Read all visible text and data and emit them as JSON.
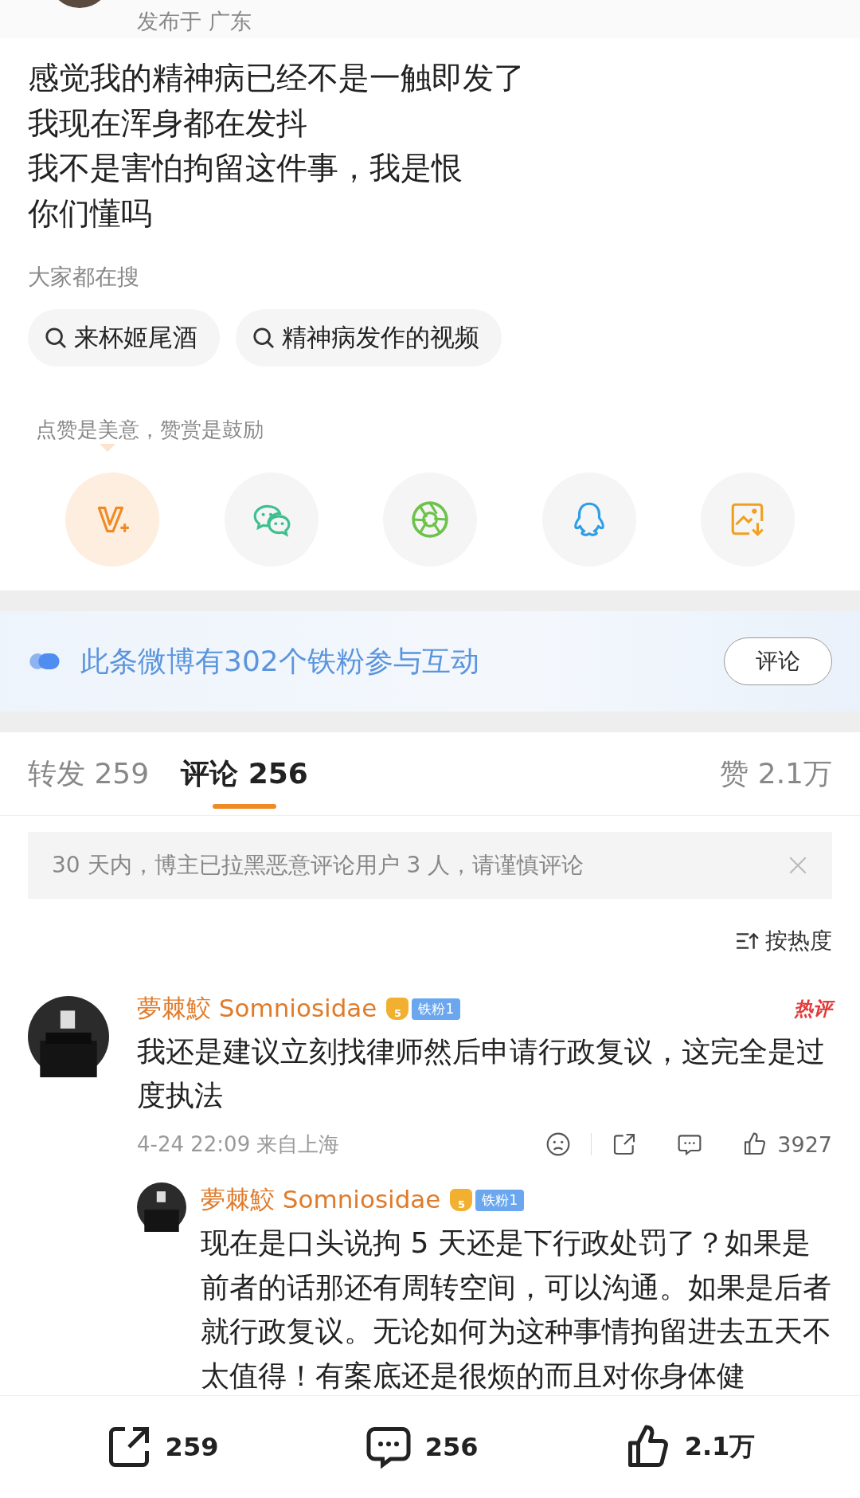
{
  "post": {
    "location": "发布于 广东",
    "lines": [
      "感觉我的精神病已经不是一触即发了",
      "我现在浑身都在发抖",
      "我不是害怕拘留这件事，我是恨",
      "你们懂吗"
    ]
  },
  "trending": {
    "title": "大家都在搜",
    "queries": [
      "来杯姬尾酒",
      "精神病发作的视频"
    ]
  },
  "tip": "点赞是美意，赞赏是鼓励",
  "share_targets": [
    {
      "kind": "reward"
    },
    {
      "kind": "wechat"
    },
    {
      "kind": "moments"
    },
    {
      "kind": "qq"
    },
    {
      "kind": "save_image"
    }
  ],
  "fans_banner": {
    "text": "此条微博有302个铁粉参与互动",
    "button": "评论"
  },
  "tabs": [
    {
      "label": "转发",
      "count": "259",
      "selected": false
    },
    {
      "label": "评论",
      "count": "256",
      "selected": true
    }
  ],
  "likes": {
    "label": "赞",
    "count": "2.1万"
  },
  "notice": "30 天内，博主已拉黑恶意评论用户 3 人，请谨慎评论",
  "sort": "按热度",
  "comments": [
    {
      "name": "夢棘鮫 Somniosidae",
      "level": "5",
      "fan_badge": "铁粉1",
      "hot_label": "热评",
      "text": "我还是建议立刻找律师然后申请行政复议，这完全是过度执法",
      "time": "4-24 22:09",
      "location": "来自上海",
      "likes": "3927",
      "replies": [
        {
          "name": "夢棘鮫 Somniosidae",
          "level": "5",
          "fan_badge": "铁粉1",
          "text": "现在是口头说拘 5 天还是下行政处罚了？如果是前者的话那还有周转空间，可以沟通。如果是后者就行政复议。无论如何为这种事情拘留进去五天不太值得！有案底还是很烦的而且对你身体健"
        }
      ]
    }
  ],
  "bottom_bar": {
    "reposts": "259",
    "comments": "256",
    "likes": "2.1万"
  }
}
